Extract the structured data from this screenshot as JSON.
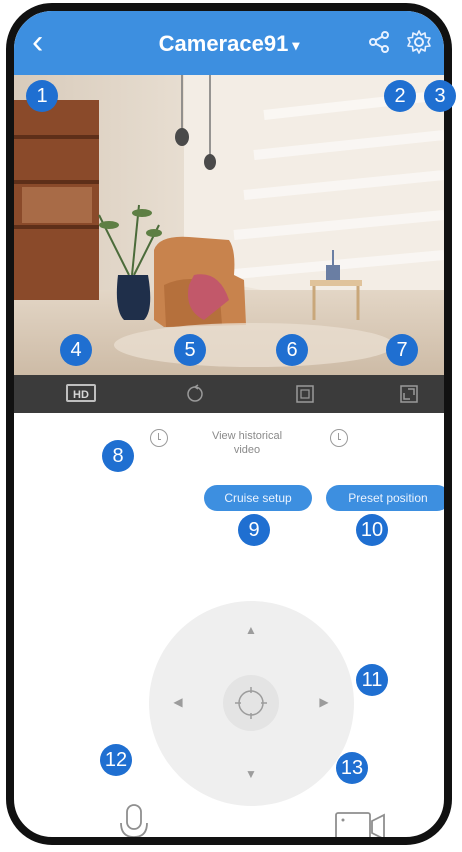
{
  "header": {
    "title": "Camerace91",
    "back_icon": "chevron-left-icon",
    "share_icon": "share-icon",
    "settings_icon": "gear-icon"
  },
  "toolbar": {
    "hd_label": "HD"
  },
  "history": {
    "label_line1": "View historical",
    "label_line2": "video"
  },
  "buttons": {
    "cruise_setup": "Cruise setup",
    "preset_position": "Preset position"
  },
  "callouts": [
    "1",
    "2",
    "3",
    "4",
    "5",
    "6",
    "7",
    "8",
    "9",
    "10",
    "11",
    "12",
    "13"
  ],
  "colors": {
    "brand_blue": "#3d8fe0",
    "callout_blue": "#1f6fd1",
    "toolbar_dark": "#3b3b3b"
  }
}
